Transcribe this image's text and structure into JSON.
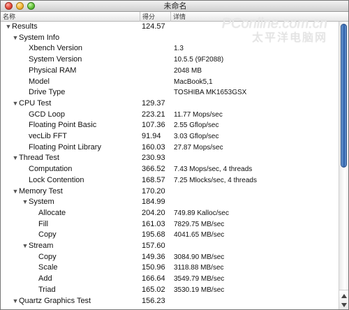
{
  "window": {
    "title": "未命名"
  },
  "watermark": {
    "line1": "PConline.com.cn",
    "line2": "太平洋电脑网"
  },
  "columns": {
    "name": "名称",
    "score": "得分",
    "detail": "详情"
  },
  "rows": [
    {
      "label": "Results",
      "score": "124.57",
      "detail": "",
      "indent": 0,
      "expander": "▼"
    },
    {
      "label": "System Info",
      "score": "",
      "detail": "",
      "indent": 1,
      "expander": "▼"
    },
    {
      "label": "Xbench Version",
      "score": "",
      "detail": "1.3",
      "indent": 2,
      "expander": ""
    },
    {
      "label": "System Version",
      "score": "",
      "detail": "10.5.5 (9F2088)",
      "indent": 2,
      "expander": ""
    },
    {
      "label": "Physical RAM",
      "score": "",
      "detail": "2048 MB",
      "indent": 2,
      "expander": ""
    },
    {
      "label": "Model",
      "score": "",
      "detail": "MacBook5,1",
      "indent": 2,
      "expander": ""
    },
    {
      "label": "Drive Type",
      "score": "",
      "detail": "TOSHIBA MK1653GSX",
      "indent": 2,
      "expander": ""
    },
    {
      "label": "CPU Test",
      "score": "129.37",
      "detail": "",
      "indent": 1,
      "expander": "▼"
    },
    {
      "label": "GCD Loop",
      "score": "223.21",
      "detail": "11.77 Mops/sec",
      "indent": 2,
      "expander": ""
    },
    {
      "label": "Floating Point Basic",
      "score": "107.36",
      "detail": "2.55 Gflop/sec",
      "indent": 2,
      "expander": ""
    },
    {
      "label": "vecLib FFT",
      "score": "91.94",
      "detail": "3.03 Gflop/sec",
      "indent": 2,
      "expander": ""
    },
    {
      "label": "Floating Point Library",
      "score": "160.03",
      "detail": "27.87 Mops/sec",
      "indent": 2,
      "expander": ""
    },
    {
      "label": "Thread Test",
      "score": "230.93",
      "detail": "",
      "indent": 1,
      "expander": "▼"
    },
    {
      "label": "Computation",
      "score": "366.52",
      "detail": "7.43 Mops/sec, 4 threads",
      "indent": 2,
      "expander": ""
    },
    {
      "label": "Lock Contention",
      "score": "168.57",
      "detail": "7.25 Mlocks/sec, 4 threads",
      "indent": 2,
      "expander": ""
    },
    {
      "label": "Memory Test",
      "score": "170.20",
      "detail": "",
      "indent": 1,
      "expander": "▼"
    },
    {
      "label": "System",
      "score": "184.99",
      "detail": "",
      "indent": 2,
      "expander": "▼"
    },
    {
      "label": "Allocate",
      "score": "204.20",
      "detail": "749.89 Kalloc/sec",
      "indent": 3,
      "expander": ""
    },
    {
      "label": "Fill",
      "score": "161.03",
      "detail": "7829.75 MB/sec",
      "indent": 3,
      "expander": ""
    },
    {
      "label": "Copy",
      "score": "195.68",
      "detail": "4041.65 MB/sec",
      "indent": 3,
      "expander": ""
    },
    {
      "label": "Stream",
      "score": "157.60",
      "detail": "",
      "indent": 2,
      "expander": "▼"
    },
    {
      "label": "Copy",
      "score": "149.36",
      "detail": "3084.90 MB/sec",
      "indent": 3,
      "expander": ""
    },
    {
      "label": "Scale",
      "score": "150.96",
      "detail": "3118.88 MB/sec",
      "indent": 3,
      "expander": ""
    },
    {
      "label": "Add",
      "score": "166.64",
      "detail": "3549.79 MB/sec",
      "indent": 3,
      "expander": ""
    },
    {
      "label": "Triad",
      "score": "165.02",
      "detail": "3530.19 MB/sec",
      "indent": 3,
      "expander": ""
    },
    {
      "label": "Quartz Graphics Test",
      "score": "156.23",
      "detail": "",
      "indent": 1,
      "expander": "▼"
    }
  ]
}
